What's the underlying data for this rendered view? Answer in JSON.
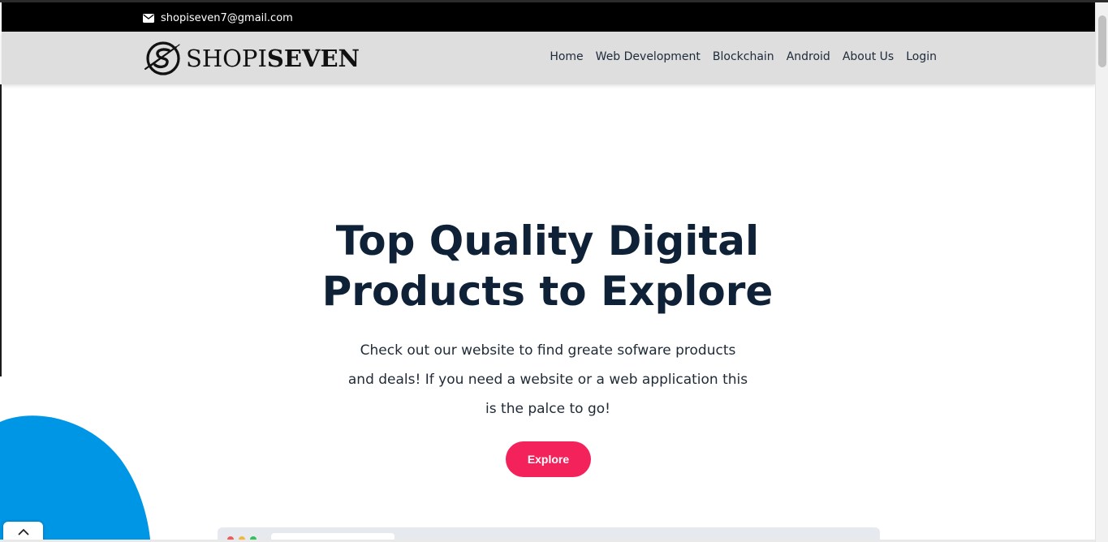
{
  "topbar": {
    "email": "shopiseven7@gmail.com",
    "email_icon": "envelope-icon"
  },
  "logo": {
    "text_light": "SHOPI",
    "text_bold": "SEVEN",
    "mark_icon": "shopiseven-logo-mark"
  },
  "nav": {
    "items": [
      {
        "label": "Home"
      },
      {
        "label": "Web Development"
      },
      {
        "label": "Blockchain"
      },
      {
        "label": "Android"
      },
      {
        "label": "About Us"
      },
      {
        "label": "Login"
      }
    ]
  },
  "hero": {
    "title_line1": "Top Quality Digital",
    "title_line2": "Products to Explore",
    "description": "Check out our website to find greate sofware products and deals! If you need a website or a web application this is the palce to go!",
    "cta_label": "Explore"
  },
  "back_to_top_icon": "chevron-up-icon",
  "colors": {
    "topbar_bg": "#000000",
    "navbar_bg": "#dedede",
    "heading": "#0f2137",
    "cta_bg": "#f4225a",
    "blob": "#0096e6"
  }
}
